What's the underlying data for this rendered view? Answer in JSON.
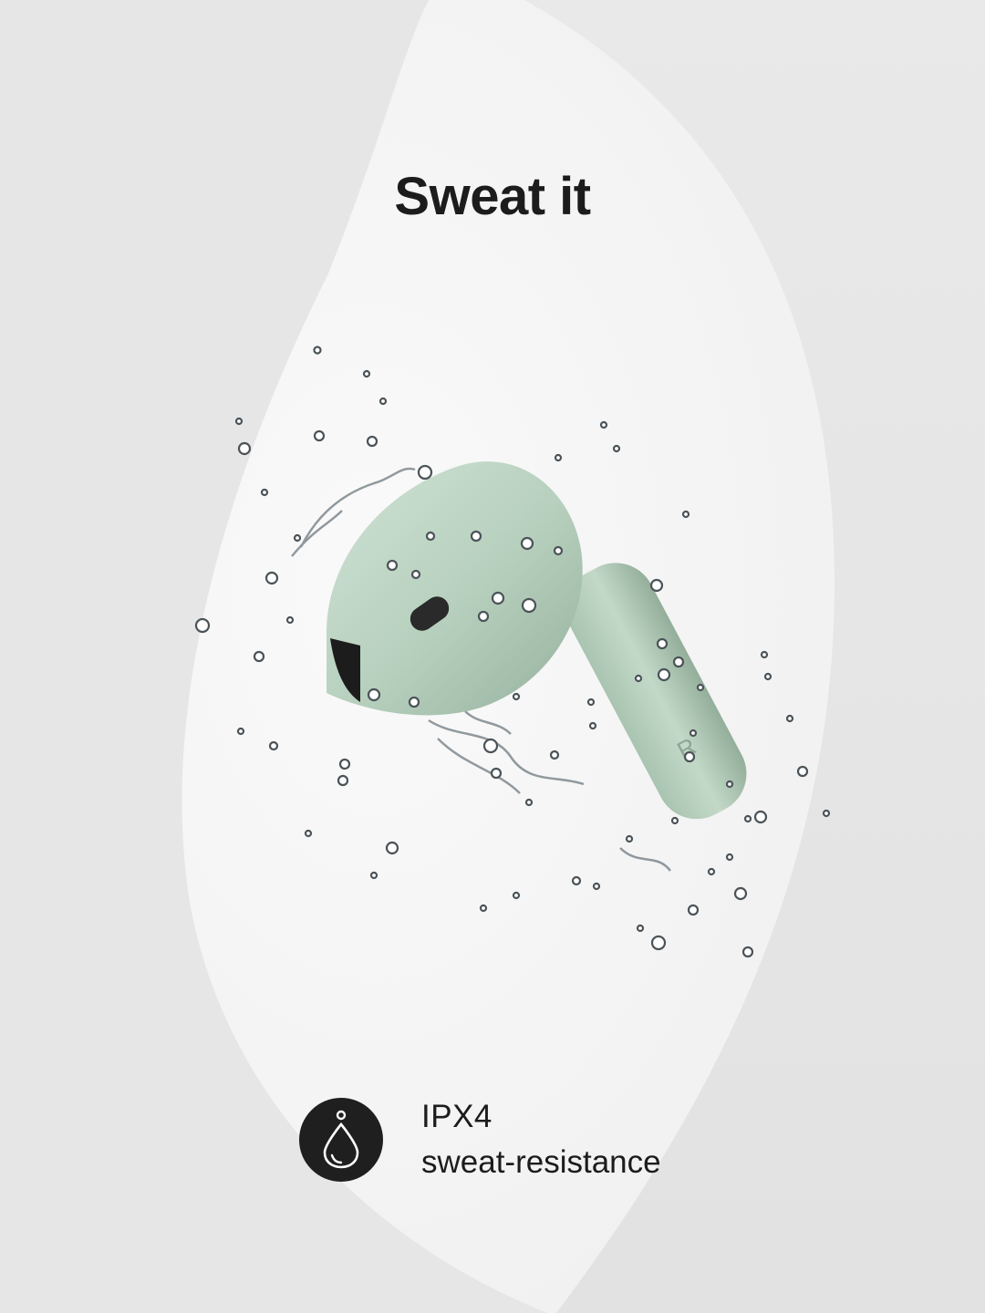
{
  "headline": "Sweat it",
  "earbud": {
    "color": "#b9d3c2",
    "side_label": "R"
  },
  "feature": {
    "icon": "water-drop-icon",
    "title": "IPX4",
    "subtitle": "sweat-resistance"
  },
  "colors": {
    "background": "#e4e4e4",
    "panel": "#f5f5f5",
    "text": "#1c1c1c",
    "icon_circle": "#1f1f1f"
  }
}
